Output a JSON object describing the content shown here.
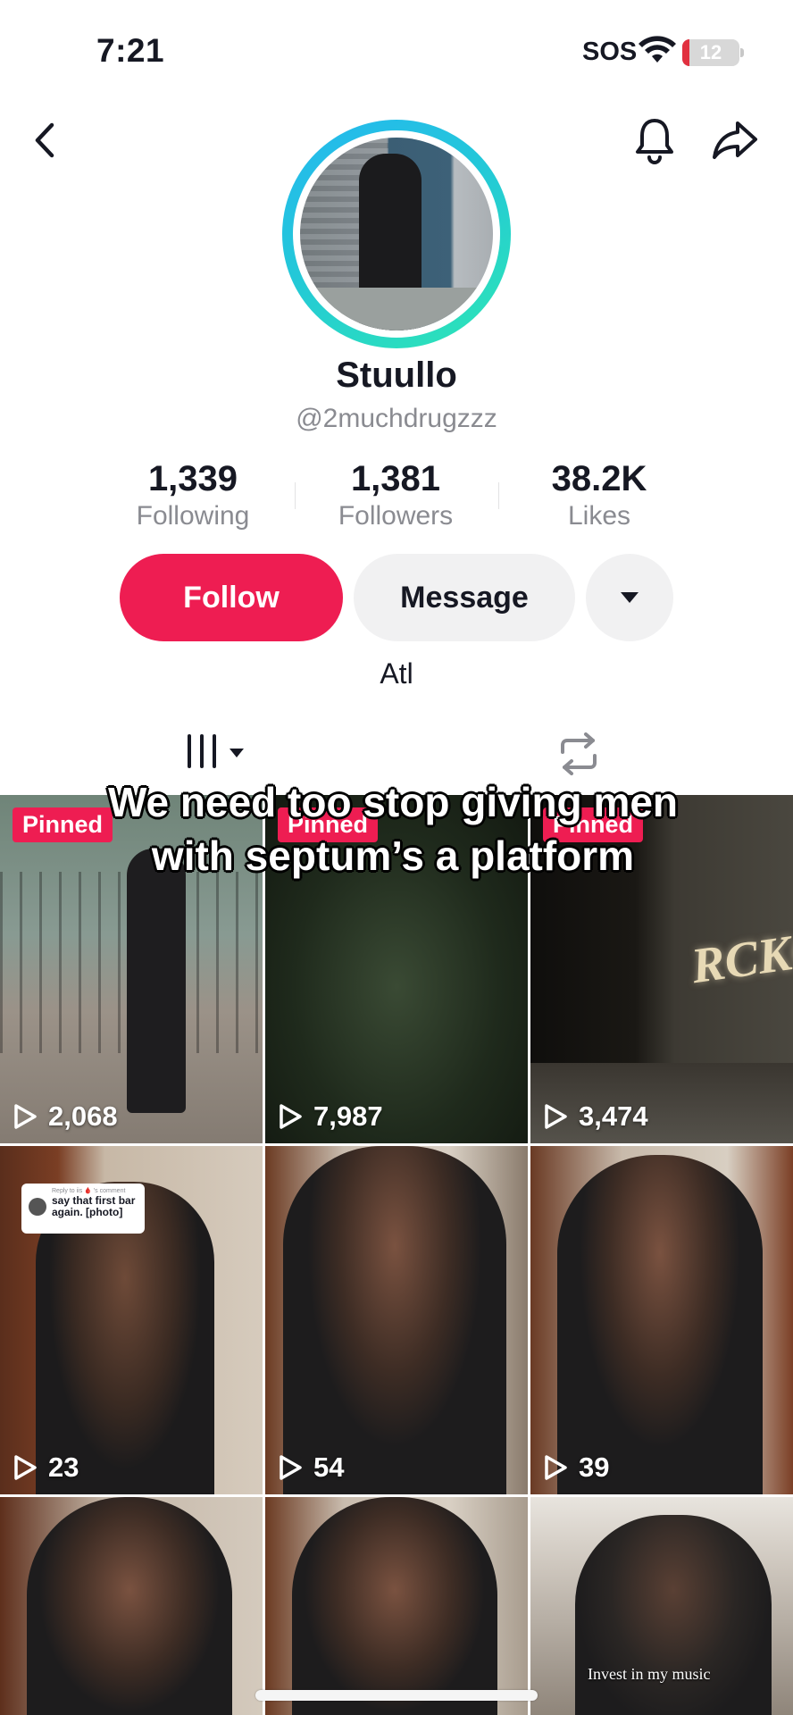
{
  "status_bar": {
    "time": "7:21",
    "carrier_status": "SOS",
    "battery_level": "12",
    "battery_fraction": 0.12,
    "battery_color": "#e1303f"
  },
  "nav": {
    "back_icon": "chevron-left-icon",
    "notification_icon": "bell-icon",
    "share_icon": "share-arrow-icon"
  },
  "profile": {
    "display_name": "Stuullo",
    "username": "@2muchdrugzzz",
    "bio": "Atl",
    "avatar_ring_colors": [
      "#25b7f0",
      "#2ee6b4"
    ]
  },
  "stats": [
    {
      "value": "1,339",
      "label": "Following"
    },
    {
      "value": "1,381",
      "label": "Followers"
    },
    {
      "value": "38.2K",
      "label": "Likes"
    }
  ],
  "actions": {
    "follow_label": "Follow",
    "message_label": "Message",
    "more_icon": "caret-down-icon",
    "accent_color": "#ee1d52"
  },
  "tabs": {
    "videos_icon": "grid-bars-icon",
    "reposts_icon": "repost-icon"
  },
  "overlay_caption": "We need too stop giving men with septum’s a platform",
  "videos": [
    {
      "pinned_label": "Pinned",
      "views": "2,068"
    },
    {
      "pinned_label": "Pinned",
      "views": "7,987"
    },
    {
      "pinned_label": "Pinned",
      "views": "3,474",
      "sign_text": "RCKO"
    },
    {
      "views": "23",
      "reply_to": "Reply to iis 🩸 's comment",
      "reply_text": "say that first bar again. [photo]"
    },
    {
      "views": "54"
    },
    {
      "views": "39"
    },
    {},
    {},
    {
      "caption": "Invest in my music"
    }
  ]
}
